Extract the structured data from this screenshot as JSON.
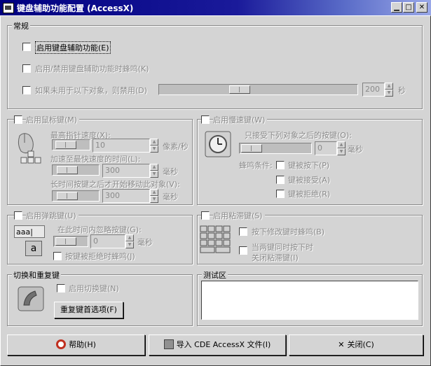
{
  "window": {
    "title": "键盘辅助功能配置 (AccessX)"
  },
  "general": {
    "title": "常规",
    "enable_keyboard_access": "启用键盘辅助功能(E)",
    "beep_on_toggle": "启用/禁用键盘辅助功能时蜂鸣(K)",
    "disable_if_unused": "如果未用于以下对象，则禁用(D)",
    "timeout_value": "200",
    "timeout_unit": "秒"
  },
  "mouse_keys": {
    "title": "启用鼠标键(M)",
    "max_speed_label": "最高指针速度(X):",
    "max_speed_value": "10",
    "max_speed_unit": "像素/秒",
    "accel_label": "加速至最快速度的时间(L):",
    "accel_value": "300",
    "accel_unit": "毫秒",
    "delay_label": "长时间按键之后才开始移动此对象(V):",
    "delay_value": "300",
    "delay_unit": "毫秒"
  },
  "slow_keys": {
    "title": "启用慢速键(W)",
    "accept_label": "只接受下列对象之后的按键(O):",
    "accept_value": "0",
    "accept_unit": "毫秒",
    "beep_label": "蜂鸣条件:",
    "pressed": "键被按下(P)",
    "accepted": "键被接受(A)",
    "rejected": "键被拒绝(R)"
  },
  "bounce_keys": {
    "title": "启用弹跳键(U)",
    "ignore_label": "在此时间内忽略按键(G):",
    "ignore_value": "0",
    "ignore_unit": "毫秒",
    "beep_rejected": "按键被拒绝时蜂鸣(J)",
    "icon_text_1": "aaa",
    "icon_text_2": "a"
  },
  "sticky_keys": {
    "title": "启用粘滞键(S)",
    "beep_modifier": "按下修改键时蜂鸣(B)",
    "disable_two_keys_1": "当两键同时按下时",
    "disable_two_keys_2": "关闭粘滞键(I)"
  },
  "toggle_repeat": {
    "title": "切换和重复键",
    "enable_toggle": "启用切换键(N)",
    "repeat_prefs_button": "重复键首选项(F)"
  },
  "test_area": {
    "title": "测试区"
  },
  "footer": {
    "help_button": "帮助(H)",
    "import_button": "导入 CDE AccessX 文件(I)",
    "close_button": "关闭(C)"
  }
}
